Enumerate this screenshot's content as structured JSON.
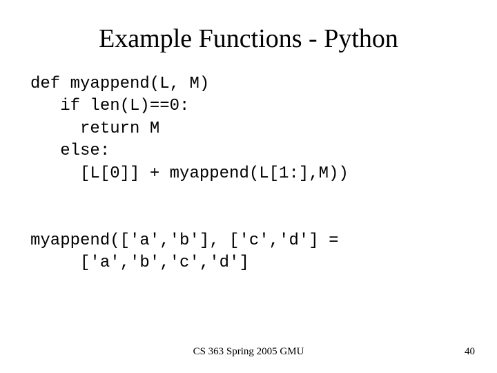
{
  "title": "Example Functions - Python",
  "code": {
    "l1": "def myappend(L, M)",
    "l2": "   if len(L)==0:",
    "l3": "     return M",
    "l4": "   else:",
    "l5": "     [L[0]] + myappend(L[1:],M))",
    "l6": "",
    "l7": "",
    "l8": "myappend(['a','b'], ['c','d'] =",
    "l9": "     ['a','b','c','d']"
  },
  "footer": {
    "center": "CS 363 Spring 2005 GMU",
    "page": "40"
  }
}
